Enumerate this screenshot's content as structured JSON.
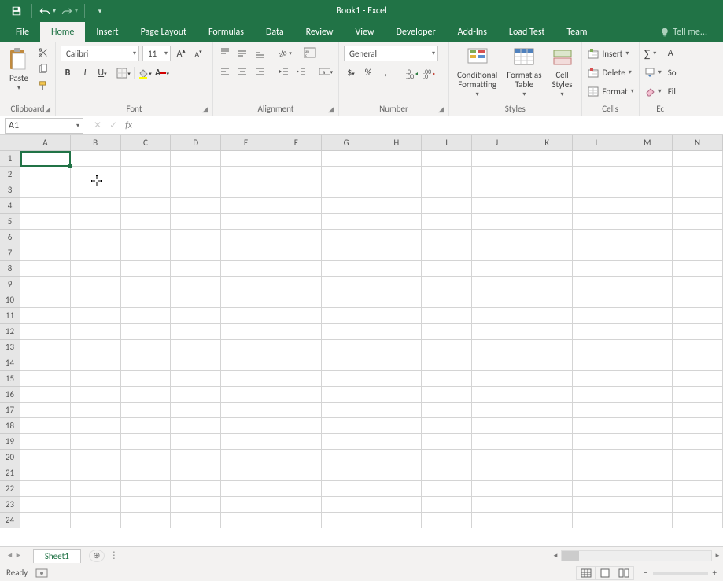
{
  "titlebar": {
    "app_title": "Book1 - Excel"
  },
  "tabs": {
    "file": "File",
    "items": [
      "Home",
      "Insert",
      "Page Layout",
      "Formulas",
      "Data",
      "Review",
      "View",
      "Developer",
      "Add-Ins",
      "Load Test",
      "Team"
    ],
    "active": "Home",
    "tell_me": "Tell me..."
  },
  "ribbon": {
    "clipboard": {
      "paste": "Paste",
      "label": "Clipboard"
    },
    "font": {
      "name": "Calibri",
      "size": "11",
      "label": "Font",
      "bold": "B",
      "italic": "I",
      "underline": "U"
    },
    "alignment": {
      "label": "Alignment"
    },
    "number": {
      "format": "General",
      "label": "Number",
      "currency": "$",
      "percent": "%",
      "comma": ","
    },
    "styles": {
      "conditional": "Conditional\nFormatting",
      "table": "Format as\nTable",
      "cell": "Cell\nStyles",
      "label": "Styles"
    },
    "cells": {
      "insert": "Insert",
      "delete": "Delete",
      "format": "Format",
      "label": "Cells"
    },
    "editing": {
      "sort": "So",
      "fil": "Fil",
      "label": "Ec"
    }
  },
  "formulabar": {
    "name_box": "A1",
    "formula": ""
  },
  "grid": {
    "columns": [
      "A",
      "B",
      "C",
      "D",
      "E",
      "F",
      "G",
      "H",
      "I",
      "J",
      "K",
      "L",
      "M",
      "N"
    ],
    "rows": [
      "1",
      "2",
      "3",
      "4",
      "5",
      "6",
      "7",
      "8",
      "9",
      "10",
      "11",
      "12",
      "13",
      "14",
      "15",
      "16",
      "17",
      "18",
      "19",
      "20",
      "21",
      "22",
      "23",
      "24"
    ],
    "selected_cell": "A1"
  },
  "sheet_tabs": {
    "active": "Sheet1"
  },
  "statusbar": {
    "ready": "Ready"
  }
}
